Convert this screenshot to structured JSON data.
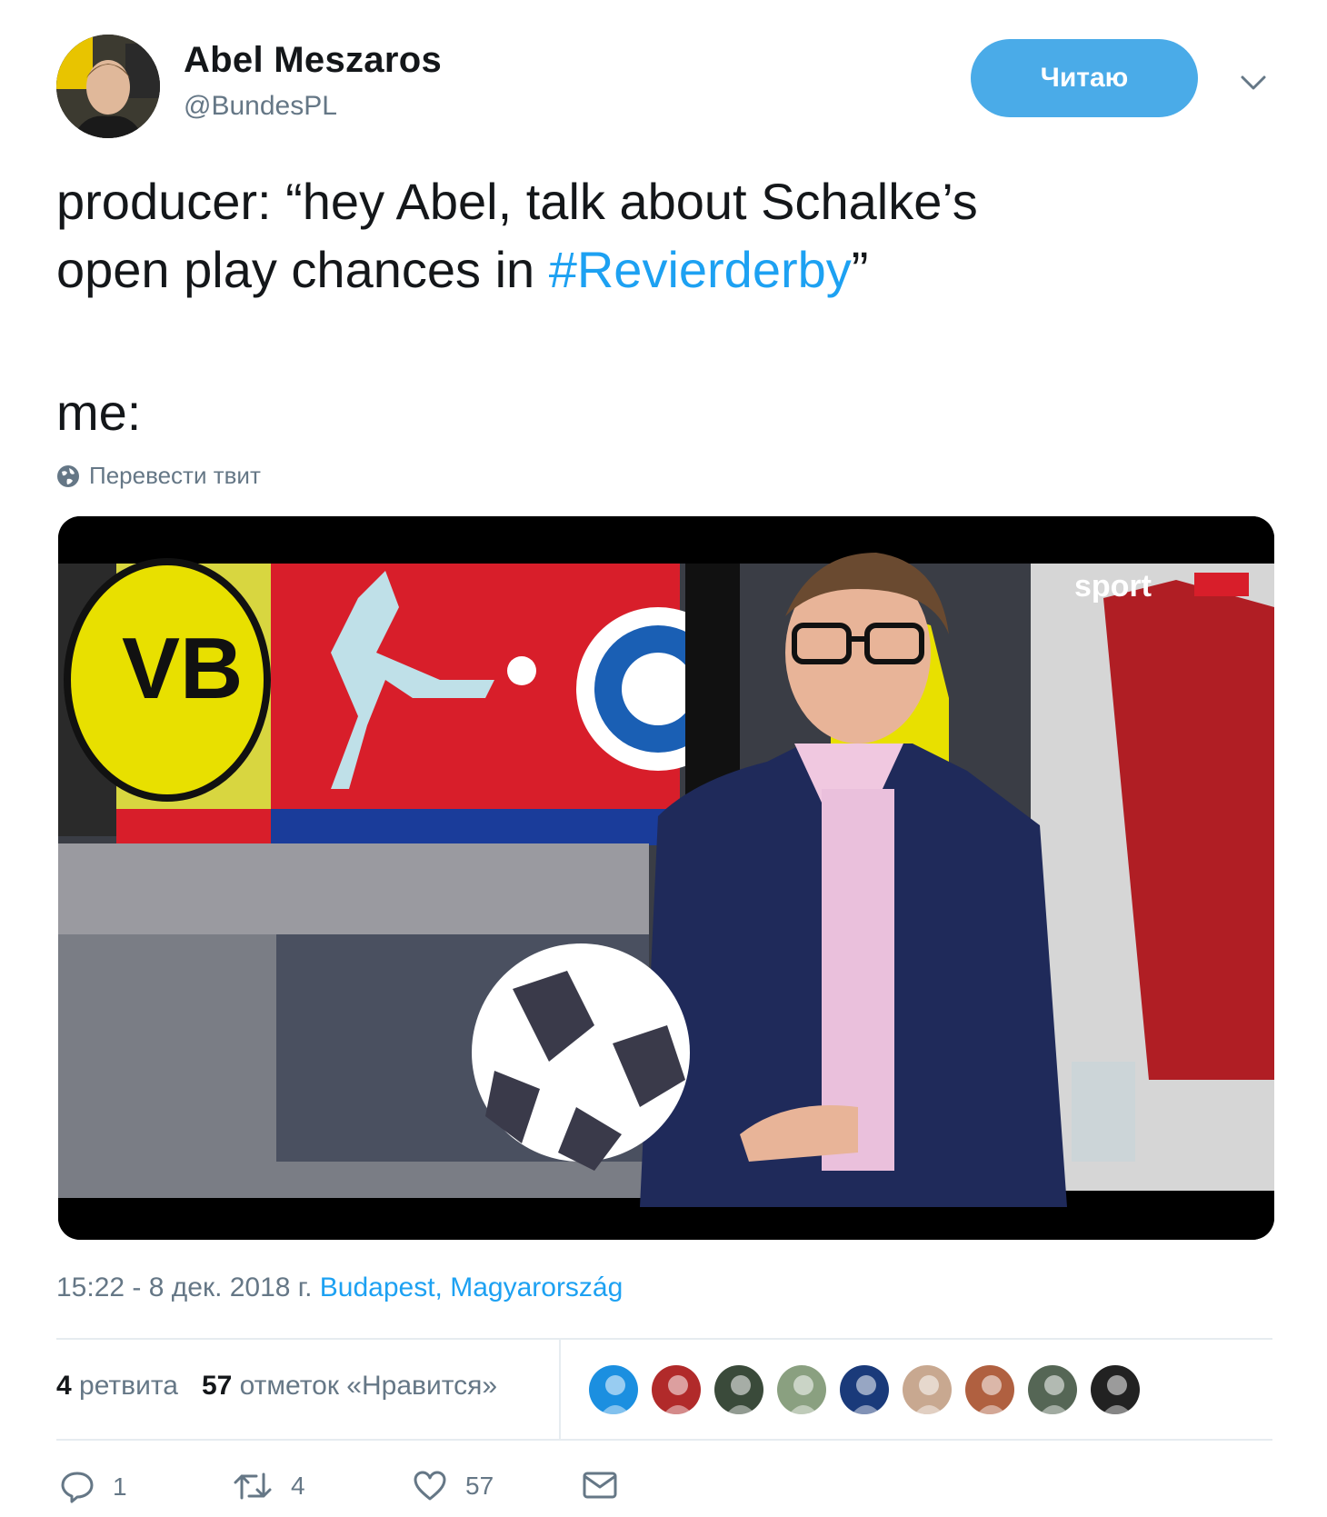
{
  "author": {
    "name": "Abel Meszaros",
    "handle": "@BundesPL",
    "avatar_icon": "profile-photo-icon"
  },
  "follow_button": {
    "label": "Читаю",
    "color": "#4aabe8"
  },
  "tweet": {
    "text_prefix": "producer: “hey Abel, talk about Schalke’s\nopen play chances in ",
    "hashtag": "#Revierderby",
    "text_suffix": "”",
    "text_me": "me:",
    "translate_label": "Перевести твит",
    "media_icon": "tv-studio-photo-icon"
  },
  "meta": {
    "time_date": "15:22 - 8 дек. 2018 г.",
    "location": "Budapest, Magyarország"
  },
  "stats": {
    "retweets_count": "4",
    "retweets_label": "ретвита",
    "likes_count": "57",
    "likes_label": "отметок «Нравится»"
  },
  "likers": [
    {
      "icon": "liker-avatar-icon",
      "color": "#1b8fe0"
    },
    {
      "icon": "liker-avatar-icon",
      "color": "#b12a2a"
    },
    {
      "icon": "liker-avatar-icon",
      "color": "#3a4a3a"
    },
    {
      "icon": "liker-avatar-icon",
      "color": "#8aa080"
    },
    {
      "icon": "liker-avatar-icon",
      "color": "#1a3a7a"
    },
    {
      "icon": "liker-avatar-icon",
      "color": "#c8a890"
    },
    {
      "icon": "liker-avatar-icon",
      "color": "#b06040"
    },
    {
      "icon": "liker-avatar-icon",
      "color": "#556655"
    },
    {
      "icon": "liker-avatar-icon",
      "color": "#222222"
    }
  ],
  "actions": {
    "reply_count": "1",
    "retweet_count": "4",
    "like_count": "57"
  },
  "colors": {
    "link": "#1da1f2",
    "secondary": "#657786",
    "primary_text": "#14171a"
  }
}
